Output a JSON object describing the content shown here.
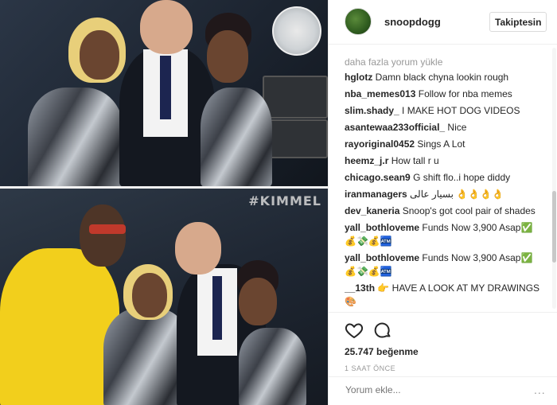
{
  "photo": {
    "watermark": "#KIMMEL"
  },
  "header": {
    "username": "snoopdogg",
    "follow_label": "Takiptesin"
  },
  "comments": {
    "load_more": "daha fazla yorum yükle",
    "items": [
      {
        "user": "hglotz",
        "text": "Damn black chyna lookin rough"
      },
      {
        "user": "nba_memes013",
        "text": "Follow for nba memes"
      },
      {
        "user": "slim.shady_",
        "text": "I MAKE HOT DOG VIDEOS"
      },
      {
        "user": "asantewaa233official_",
        "text": "Nice"
      },
      {
        "user": "rayoriginal0452",
        "text": "Sings A Lot"
      },
      {
        "user": "heemz_j.r",
        "text": "How tall r u"
      },
      {
        "user": "chicago.sean9",
        "text": "G shift flo..i hope diddy"
      },
      {
        "user": "iranmanagers",
        "text": "بسیار عالی 👌👌👌👌"
      },
      {
        "user": "dev_kaneria",
        "text": "Snoop's got cool pair of shades"
      },
      {
        "user": "yall_bothloveme",
        "text": "Funds Now 3,900 Asap✅ 💰💸💰🏧"
      },
      {
        "user": "yall_bothloveme",
        "text": "Funds Now 3,900 Asap✅ 💰💸💰🏧"
      },
      {
        "user": "__13th",
        "text": "👉 HAVE A LOOK AT MY DRAWINGS 🎨"
      }
    ]
  },
  "actions": {
    "like_icon": "heart-icon",
    "comment_icon": "comment-icon",
    "likes": "25.747 beğenme",
    "timestamp": "1 SAAT ÖNCE"
  },
  "add_comment": {
    "placeholder": "Yorum ekle...",
    "more": "..."
  }
}
